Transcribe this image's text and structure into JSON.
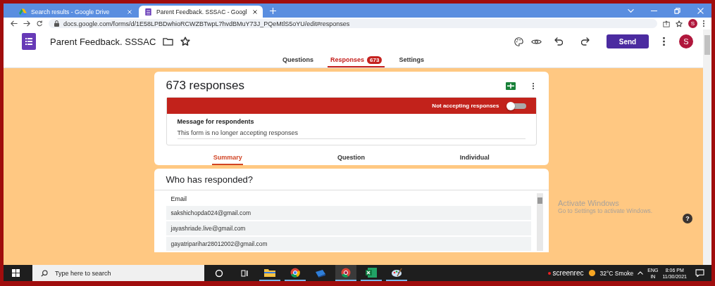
{
  "browser": {
    "tabs": [
      {
        "title": "Search results - Google Drive",
        "selected": false
      },
      {
        "title": "Parent Feedback. SSSAC - Googl",
        "selected": true
      }
    ],
    "url": "docs.google.com/forms/d/1E58LPBDwhioRCWZBTwpL7hvdBMuY73J_PQeMtlS5oYU/edit#responses",
    "profile": "S"
  },
  "form_header": {
    "title": "Parent Feedback. SSSAC",
    "send_label": "Send",
    "avatar": "S"
  },
  "form_tabs": [
    {
      "label": "Questions",
      "selected": false
    },
    {
      "label": "Responses",
      "badge": "673",
      "selected": true
    },
    {
      "label": "Settings",
      "selected": false
    }
  ],
  "responses_card": {
    "title": "673 responses",
    "banner": {
      "label": "Not accepting responses",
      "on": false
    },
    "message_label": "Message for respondents",
    "message": "This form is no longer accepting responses",
    "view_tabs": [
      {
        "label": "Summary",
        "selected": true
      },
      {
        "label": "Question",
        "selected": false
      },
      {
        "label": "Individual",
        "selected": false
      }
    ]
  },
  "who_card": {
    "title": "Who has responded?",
    "column": "Email",
    "rows": [
      "sakshichopda024@gmail.com",
      "jayashriade.live@gmail.com",
      "gayatriparihar28012002@gmail.com"
    ]
  },
  "activation": {
    "title": "Activate Windows",
    "subtitle": "Go to Settings to activate Windows."
  },
  "help": "?",
  "taskbar": {
    "search_placeholder": "Type here to search",
    "recorder": "screenrec",
    "weather": "32°C  Smoke",
    "lang": "ENG",
    "region": "IN",
    "time": "8:06 PM",
    "date": "11/30/2021"
  }
}
